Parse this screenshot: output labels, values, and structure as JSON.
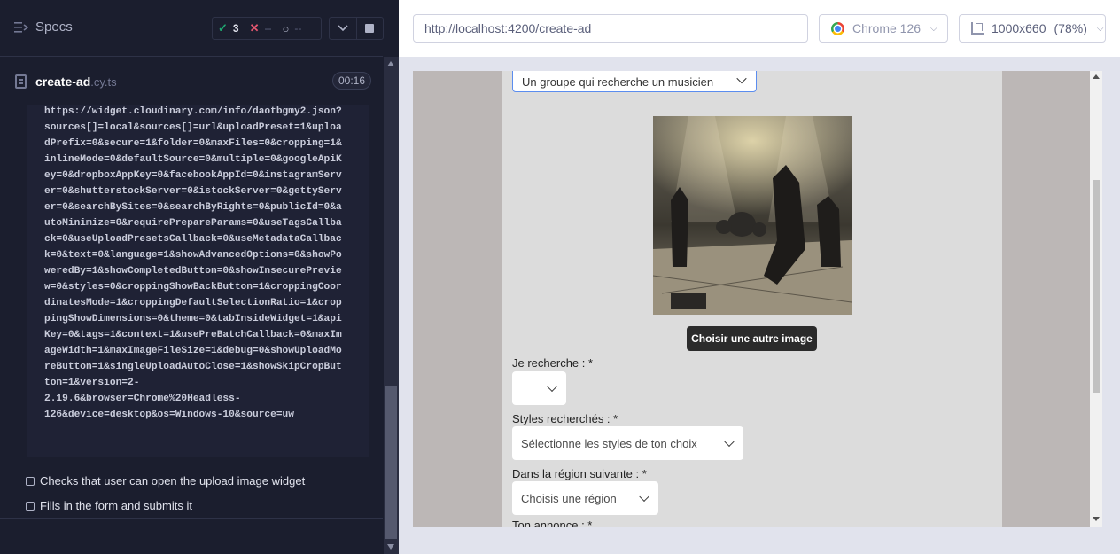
{
  "reporter": {
    "specs_label": "Specs",
    "stats": {
      "passed": "3",
      "failed": "--",
      "pending": "--"
    },
    "spec": {
      "name": "create-ad",
      "ext": ".cy.ts",
      "duration": "00:16"
    },
    "log_text": "https://widget.cloudinary.com/info/daotbgmy2.json?\nsources[]=local&sources[]=url&uploadPreset=1&uploadPrefix=0&secure=1&folder=0&maxFiles=0&cropping=1&inlineMode=0&defaultSource=0&multiple=0&googleApiKey=0&dropboxAppKey=0&facebookAppId=0&instagramServer=0&shutterstockServer=0&istockServer=0&gettyServer=0&searchBySites=0&searchByRights=0&publicId=0&autoMinimize=0&requirePrepareParams=0&useTagsCallback=0&useUploadPresetsCallback=0&useMetadataCallback=0&text=0&language=1&showAdvancedOptions=0&showPoweredBy=1&showCompletedButton=0&showInsecurePreview=0&styles=0&croppingShowBackButton=1&croppingCoordinatesMode=1&croppingDefaultSelectionRatio=1&croppingShowDimensions=0&theme=0&tabInsideWidget=1&apiKey=0&tags=1&context=1&usePreBatchCallback=0&maxImageWidth=1&maxImageFileSize=1&debug=0&showUploadMoreButton=1&singleUploadAutoClose=1&showSkipCropButton=1&version=2-\n2.19.6&browser=Chrome%20Headless-\n126&device=desktop&os=Windows-10&source=uw",
    "tests": [
      "Checks that user can open the upload image widget",
      "Fills in the form and submits it"
    ]
  },
  "aut": {
    "url": "http://localhost:4200/create-ad",
    "browser": "Chrome 126",
    "viewport": "1000x660",
    "scale": "(78%)"
  },
  "app": {
    "ad_type_value": "Un groupe qui recherche un musicien",
    "change_image_label": "Choisir une autre image",
    "seek_label": "Je recherche : *",
    "seek_value": "",
    "styles_label": "Styles recherchés : *",
    "styles_placeholder": "Sélectionne les styles de ton choix",
    "region_label": "Dans la région suivante : *",
    "region_placeholder": "Choisis une région",
    "ad_label": "Ton annonce : *"
  },
  "colors": {
    "reporter_bg": "#1b1e2e",
    "pass": "#1fa971",
    "fail": "#e45770",
    "focus_border": "#5b8def",
    "button_dark": "#2b2b2b"
  }
}
